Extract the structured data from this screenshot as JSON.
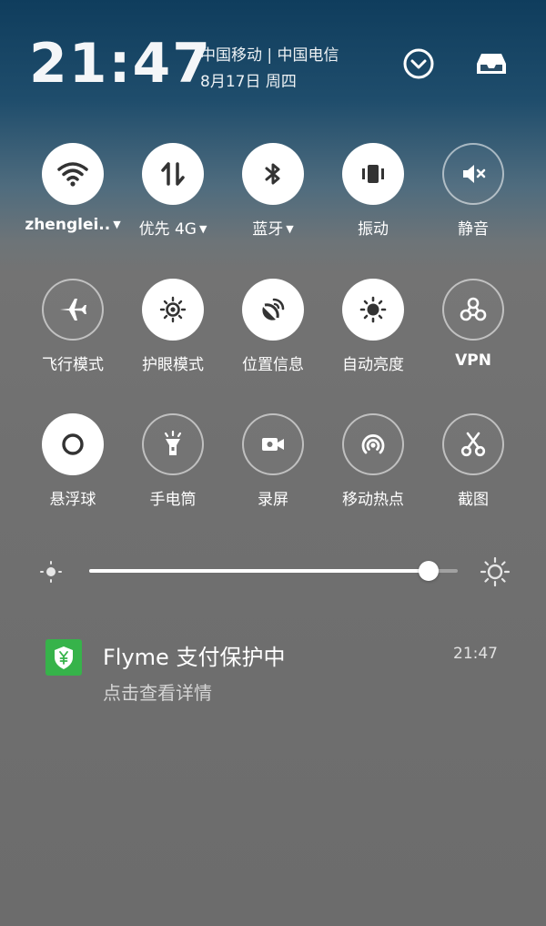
{
  "status": {
    "time": "21:47",
    "carrier": "中国移动 | 中国电信",
    "date": "8月17日 周四"
  },
  "header_icons": {
    "expand": "chevron-down-circle-icon",
    "inbox": "inbox-tray-icon"
  },
  "tiles": [
    {
      "label": "zhenglei..",
      "caret": "▼",
      "icon": "wifi-icon",
      "on": true
    },
    {
      "label": "优先 4G",
      "caret": "▼",
      "icon": "mobile-data-icon",
      "on": true
    },
    {
      "label": "蓝牙",
      "caret": "▼",
      "icon": "bluetooth-icon",
      "on": true
    },
    {
      "label": "振动",
      "caret": "",
      "icon": "vibrate-icon",
      "on": true
    },
    {
      "label": "静音",
      "caret": "",
      "icon": "mute-icon",
      "on": false
    },
    {
      "label": "飞行模式",
      "caret": "",
      "icon": "airplane-icon",
      "on": false
    },
    {
      "label": "护眼模式",
      "caret": "",
      "icon": "eye-protection-icon",
      "on": true
    },
    {
      "label": "位置信息",
      "caret": "",
      "icon": "location-icon",
      "on": true
    },
    {
      "label": "自动亮度",
      "caret": "",
      "icon": "auto-brightness-icon",
      "on": true
    },
    {
      "label": "VPN",
      "caret": "",
      "icon": "vpn-icon",
      "on": false
    },
    {
      "label": "悬浮球",
      "caret": "",
      "icon": "floating-ball-icon",
      "on": true
    },
    {
      "label": "手电筒",
      "caret": "",
      "icon": "flashlight-icon",
      "on": false
    },
    {
      "label": "录屏",
      "caret": "",
      "icon": "screen-record-icon",
      "on": false
    },
    {
      "label": "移动热点",
      "caret": "",
      "icon": "hotspot-icon",
      "on": false
    },
    {
      "label": "截图",
      "caret": "",
      "icon": "screenshot-icon",
      "on": false
    }
  ],
  "brightness": {
    "level": 0.92
  },
  "notification": {
    "title": "Flyme 支付保护中",
    "time": "21:47",
    "body": "点击查看详情",
    "icon": "payment-shield-icon",
    "icon_color": "#36b34a"
  }
}
